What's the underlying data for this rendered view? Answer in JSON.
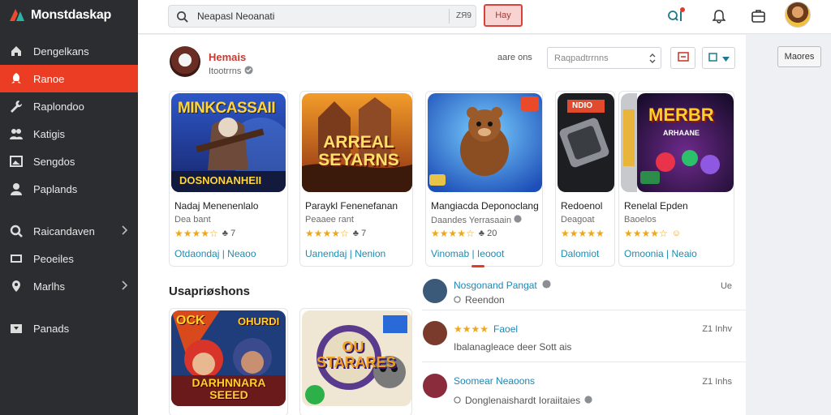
{
  "app": {
    "title": "Monstdaskap"
  },
  "sidebar": {
    "items": [
      {
        "label": "Dengelkans",
        "icon": "home-icon"
      },
      {
        "label": "Ranoe",
        "icon": "rocket-icon",
        "active": true
      },
      {
        "label": "Raplondoo",
        "icon": "wrench-icon"
      },
      {
        "label": "Katigis",
        "icon": "users-icon"
      },
      {
        "label": "Sengdos",
        "icon": "image-icon"
      },
      {
        "label": "Paplands",
        "icon": "user-icon"
      },
      {
        "label": "Raicandaven",
        "icon": "search-icon",
        "chevron": true
      },
      {
        "label": "Peoeiles",
        "icon": "monitor-icon"
      },
      {
        "label": "Marlhs",
        "icon": "map-pin-icon",
        "chevron": true
      },
      {
        "label": "Panads",
        "icon": "download-icon"
      }
    ]
  },
  "topbar": {
    "search_value": "Neapasl Neoanati",
    "search_ext": "ZЯ9",
    "play_label": "Hay",
    "icons": [
      "qi-search-icon",
      "bell-icon",
      "store-icon",
      "avatar"
    ]
  },
  "publisher": {
    "name": "Hemais",
    "sub": "Itootrrns"
  },
  "sort": {
    "label": "aare ons",
    "placeholder": "Raqpadtrrnns"
  },
  "games": [
    {
      "title": "Nadaj Menenenlalo",
      "dev": "Dea bant",
      "stars": "★★★★☆",
      "rating": "♣ 7",
      "category": "Otdaondaj | Neaoo",
      "art": "MINKCASSAII",
      "art_sub": "DOSNONANHEII"
    },
    {
      "title": "Paraykl Fenenefanan",
      "dev": "Peaaee rant",
      "stars": "★★★★☆",
      "rating": "♣ 7",
      "category": "Uanendaj | Nenion",
      "art": "ARREAL SEYARNS",
      "art_sub": ""
    },
    {
      "title": "Mangiacda Deponoclang",
      "dev": "Daandes Yerrasaain",
      "stars": "★★★★☆",
      "rating": "♣ 20",
      "category": "Vinomab | Ieooot",
      "art": "",
      "art_sub": ""
    },
    {
      "title": "Redoenol",
      "dev": "Deagoat",
      "stars": "★★★★★",
      "rating": "",
      "category": "Dalomiot",
      "art": "NDIO",
      "art_sub": ""
    },
    {
      "title": "Renelal Epden",
      "dev": "Baoelos",
      "stars": "★★★★☆",
      "rating": "☺",
      "category": "Omoonia | Neaio",
      "art": "MERBR",
      "art_sub": "ARHAANE"
    }
  ],
  "section": {
    "title": "Usapriøshons"
  },
  "section_games": [
    {
      "art": "OCK",
      "art_sub": "OHURDI",
      "art_bottom": "DARHNNARA SEEED"
    },
    {
      "art": "OU STARARES",
      "art_sub": "",
      "art_bottom": ""
    }
  ],
  "activity": [
    {
      "title": "Nosgonand Pangat",
      "sub": "Reendon",
      "time": "Ue",
      "avatar_color": "#3b5a7a"
    },
    {
      "title": "Faoel",
      "stars": "★★★★",
      "sub": "Ibalanagleace deer Sott ais",
      "time": "Z1 Inhv",
      "avatar_color": "#7a3b2c"
    },
    {
      "title": "Soomear Neaoons",
      "sub": "Donglenaishardt Ioraiitaies",
      "time": "Z1 Inhs",
      "avatar_color": "#8a2c3c"
    }
  ],
  "right_panel": {
    "button_label": "Maores"
  },
  "colors": {
    "accent": "#ea3d24",
    "sidebar_bg": "#2b2d30",
    "link": "#1e8bb0",
    "star": "#f2a613"
  }
}
